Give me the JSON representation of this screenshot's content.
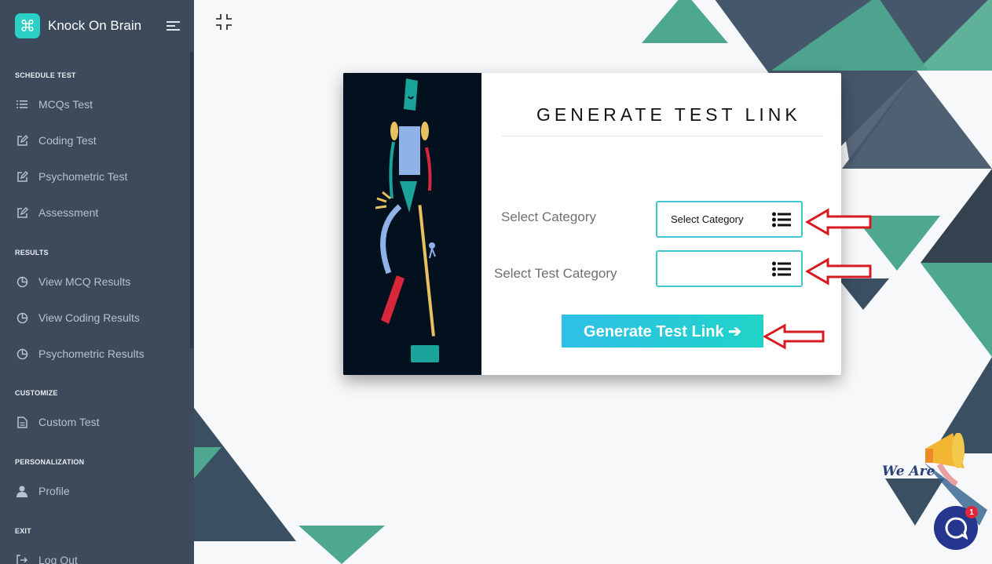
{
  "brand": {
    "name": "Knock On Brain",
    "logo_glyph": "⌘",
    "logo_color": "#2ad0c6"
  },
  "sidebar": {
    "sections": [
      {
        "title": "SCHEDULE TEST"
      },
      {
        "title": "RESULTS"
      },
      {
        "title": "CUSTOMIZE"
      },
      {
        "title": "PERSONALIZATION"
      },
      {
        "title": "EXIT"
      }
    ],
    "items": [
      {
        "label": "MCQs Test",
        "icon": "list-icon"
      },
      {
        "label": "Coding Test",
        "icon": "edit-icon"
      },
      {
        "label": "Psychometric Test",
        "icon": "edit-icon"
      },
      {
        "label": "Assessment",
        "icon": "edit-icon"
      },
      {
        "label": "View MCQ Results",
        "icon": "pie-chart-icon"
      },
      {
        "label": "View Coding Results",
        "icon": "pie-chart-icon"
      },
      {
        "label": "Psychometric Results",
        "icon": "pie-chart-icon"
      },
      {
        "label": "Custom Test",
        "icon": "file-icon"
      },
      {
        "label": "Profile",
        "icon": "user-icon"
      },
      {
        "label": "Log Out",
        "icon": "logout-icon"
      }
    ]
  },
  "card": {
    "title": "GENERATE TEST LINK",
    "category_label": "Select Category",
    "category_value": "Select Category",
    "test_category_label": "Select Test Category",
    "test_category_value": "",
    "button_label": "Generate Test Link ➔"
  },
  "promo": {
    "text": "We Are",
    "badge_count": "1"
  },
  "colors": {
    "sidebar_bg": "#3d4a5c",
    "accent": "#40c6cf",
    "teal": "#4ea88f",
    "slate": "#3b4f63",
    "arrow_red": "#d71920"
  }
}
